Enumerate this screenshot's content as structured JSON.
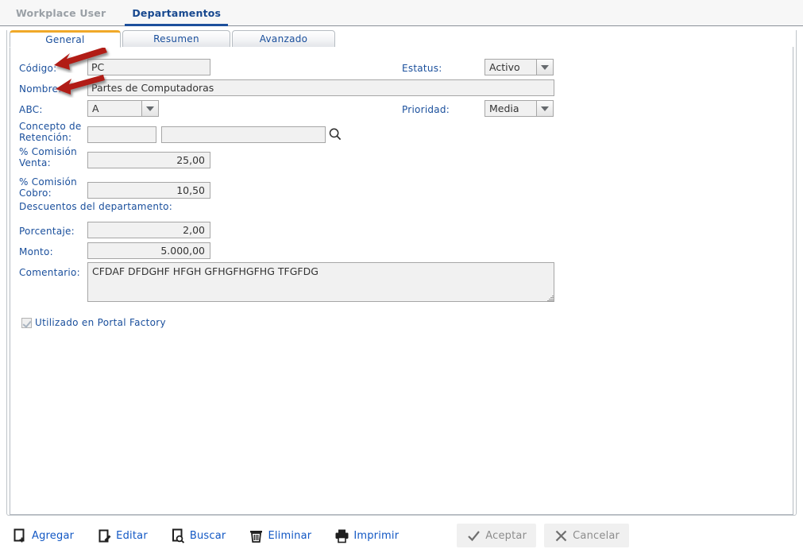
{
  "appbar": {
    "breadcrumb": "Workplace User",
    "active_tab": "Departamentos"
  },
  "tabs": [
    {
      "label": "General",
      "active": true
    },
    {
      "label": "Resumen",
      "active": false
    },
    {
      "label": "Avanzado",
      "active": false
    }
  ],
  "form": {
    "codigo": {
      "label": "Código:",
      "value": "PC"
    },
    "nombre": {
      "label": "Nombre:",
      "value": "Partes de Computadoras"
    },
    "abc": {
      "label": "ABC:",
      "value": "A"
    },
    "estatus": {
      "label": "Estatus:",
      "value": "Activo"
    },
    "prioridad": {
      "label": "Prioridad:",
      "value": "Media"
    },
    "concepto_retencion": {
      "label": "Concepto de\nRetención:",
      "code": "",
      "desc": ""
    },
    "comision_venta": {
      "label": "% Comisión\nVenta:",
      "value": "25,00"
    },
    "comision_cobro": {
      "label": "% Comisión\nCobro:",
      "value": "10,50"
    },
    "descuentos_header": "Descuentos del departamento:",
    "porcentaje": {
      "label": "Porcentaje:",
      "value": "2,00"
    },
    "monto": {
      "label": "Monto:",
      "value": "5.000,00"
    },
    "comentario": {
      "label": "Comentario:",
      "value": "CFDAF DFDGHF HFGH GFHGFHGFHG TFGFDG"
    },
    "portal_factory": {
      "label": "Utilizado en Portal Factory",
      "checked": true
    }
  },
  "toolbar": {
    "agregar": "Agregar",
    "editar": "Editar",
    "buscar": "Buscar",
    "eliminar": "Eliminar",
    "imprimir": "Imprimir",
    "aceptar": "Aceptar",
    "cancelar": "Cancelar"
  },
  "colors": {
    "accent_orange": "#f0a929",
    "link_blue": "#1157c4",
    "label_blue": "#1a4f9c",
    "arrow_red": "#b11f16",
    "field_bg": "#f1f1f1"
  }
}
